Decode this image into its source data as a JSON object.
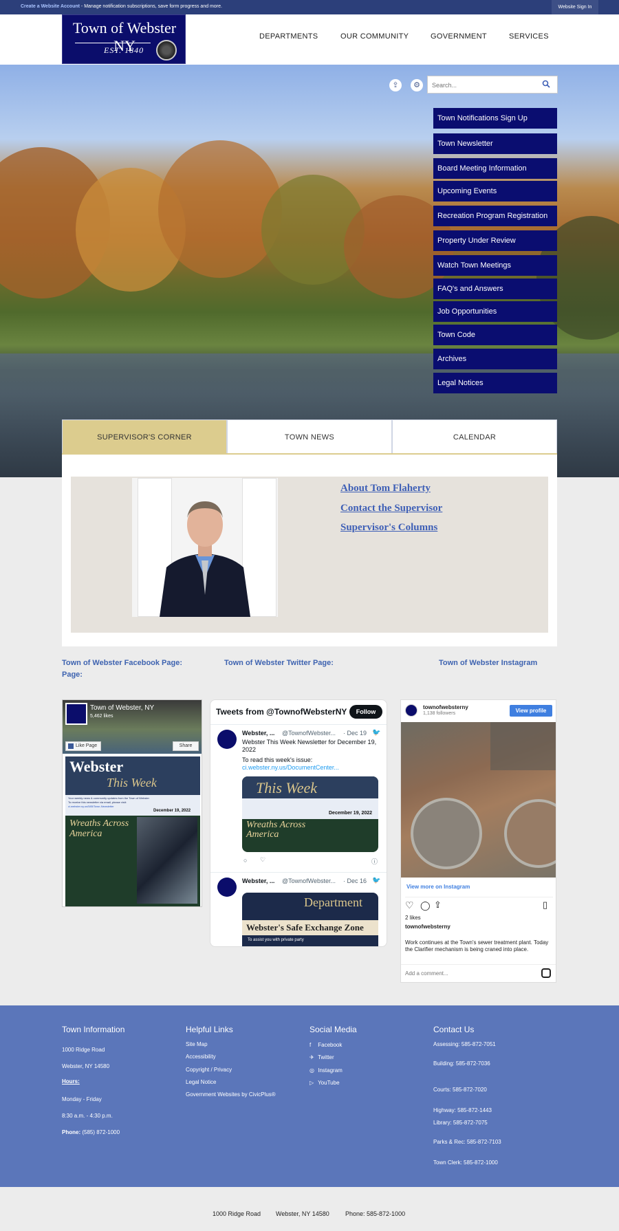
{
  "topbar": {
    "create_account": "Create a Website Account",
    "message": " - Manage notification subscriptions, save form progress and more.",
    "signin": "Website Sign In"
  },
  "logo": {
    "title": "Town of Webster NY",
    "est": "EST. 1840"
  },
  "nav": [
    "DEPARTMENTS",
    "OUR COMMUNITY",
    "GOVERNMENT",
    "SERVICES"
  ],
  "search": {
    "placeholder": "Search..."
  },
  "quick_links": [
    "Town Notifications Sign Up",
    "Town Newsletter",
    "Board Meeting Information",
    "Upcoming Events",
    "Recreation Program Registration",
    "Property Under Review",
    "Watch Town Meetings",
    "FAQ's and Answers",
    "Job Opportunities",
    "Town Code",
    "Archives",
    "Legal Notices"
  ],
  "tabs": [
    "SUPERVISOR'S CORNER",
    "TOWN NEWS",
    "CALENDAR"
  ],
  "supervisor_links": [
    "About Tom Flaherty",
    "Contact the Supervisor",
    "Supervisor's Columns"
  ],
  "social_headings": {
    "facebook": "Town of Webster Facebook Page:",
    "facebook_page": "Page:",
    "twitter": "Town of Webster Twitter Page:",
    "instagram": "Town of Webster Instagram"
  },
  "facebook": {
    "name": "Town of Webster, NY",
    "likes": "5,462 likes",
    "like_btn": "Like Page",
    "share_btn": "Share",
    "post_title": "Webster",
    "post_subtitle": "This Week",
    "post_line1": "Your weekly news & community updates from the Town of Webster",
    "post_line2": "To receive this newsletter via email, please visit:",
    "post_url": "ci.webster.ny.us/585/Town-Newsletter",
    "post_date": "December 19, 2022",
    "wreaths_title": "Wreaths Across America"
  },
  "twitter": {
    "header": "Tweets from @TownofWebsterNY",
    "follow": "Follow",
    "tweet1": {
      "name": "Webster, ...",
      "handle": "@TownofWebster...",
      "date": "· Dec 19",
      "text": "Webster This Week Newsletter for December 19, 2022",
      "text2": "To read this week's issue:",
      "link": "ci.webster.ny.us/DocumentCenter...",
      "img_title": "This Week",
      "img_date": "December 19, 2022",
      "img_sub": "Wreaths Across America"
    },
    "tweet2": {
      "name": "Webster, ...",
      "handle": "@TownofWebster...",
      "date": "· Dec 16",
      "img_title": "Department",
      "img_sub": "Webster's Safe Exchange Zone",
      "img_line": "To assist you with private party"
    }
  },
  "instagram": {
    "username": "townofwebsterny",
    "followers": "1,138 followers",
    "view_profile": "View profile",
    "view_more": "View more on Instagram",
    "likes": "2 likes",
    "caption_user": "townofwebsterny",
    "caption": "Work continues at the Town's sewer treatment plant. Today the Clarifier mechanism is being craned into place.",
    "comment_placeholder": "Add a comment..."
  },
  "footer": {
    "town_info": {
      "title": "Town Information",
      "address1": "1000 Ridge Road",
      "address2": "Webster, NY 14580",
      "hours_label": "Hours:",
      "days": "Monday - Friday",
      "times": "8:30 a.m. - 4:30 p.m.",
      "phone_label": "Phone:",
      "phone": " (585) 872-1000"
    },
    "helpful": {
      "title": "Helpful Links",
      "links": [
        "Site Map",
        "Accessibility",
        "Copyright / Privacy",
        "Legal Notice",
        "Government Websites by CivicPlus®"
      ]
    },
    "social": {
      "title": "Social Media",
      "links": [
        "Facebook",
        "Twitter",
        "Instagram",
        "YouTube"
      ]
    },
    "contact": {
      "title": "Contact Us",
      "lines": [
        "Assessing:   585-872-7051",
        "Building:   585-872-7036",
        "Courts: 585-872-7020",
        "Highway:   585-872-1443",
        "Library:   585-872-7075",
        "Parks & Rec:   585-872-7103",
        "Town Clerk:   585-872-1000"
      ]
    }
  },
  "bottom": {
    "address": "1000 Ridge Road",
    "city": "Webster, NY 14580",
    "phone": "Phone: 585-872-1000"
  }
}
